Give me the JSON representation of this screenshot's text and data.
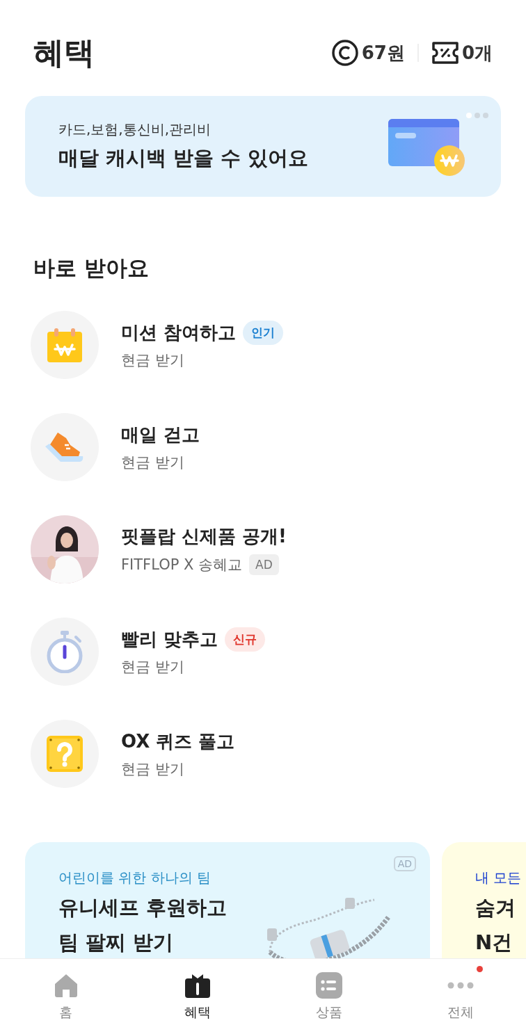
{
  "header": {
    "title": "혜택",
    "points": "67원",
    "coupons": "0개"
  },
  "banner": {
    "subtitle": "카드,보험,통신비,관리비",
    "title": "매달 캐시백 받을 수 있어요",
    "pages": [
      {
        "selected": true
      },
      {
        "selected": false
      },
      {
        "selected": false
      }
    ]
  },
  "section_title": "바로 받아요",
  "items": [
    {
      "kind": "calendar",
      "title": "미션 참여하고",
      "subtitle": "현금 받기",
      "badge": {
        "text": "인기",
        "kind": "popular"
      }
    },
    {
      "kind": "shoe",
      "title": "매일 걷고",
      "subtitle": "현금 받기"
    },
    {
      "kind": "picture",
      "title": "핏플랍 신제품 공개!",
      "subtitle": "FITFLOP X 송혜교",
      "badge": {
        "text": "AD",
        "kind": "ad"
      }
    },
    {
      "kind": "stopwatch",
      "title": "빨리 맞추고",
      "subtitle": "현금 받기",
      "badge": {
        "text": "신규",
        "kind": "new"
      }
    },
    {
      "kind": "quiz",
      "title": "OX 퀴즈 풀고",
      "subtitle": "현금 받기"
    }
  ],
  "promo_cards": [
    {
      "eyebrow": "어린이를 위한 하나의 팀",
      "title_lines": [
        "유니세프 후원하고",
        "팀 팔찌 받기"
      ],
      "ad_label": "AD",
      "color": "#e3f6fd",
      "kind": "bracelet"
    },
    {
      "eyebrow": "내 모든",
      "title_lines": [
        "숨겨",
        "N건"
      ],
      "color": "#fffde3",
      "kind": "plain"
    }
  ],
  "nav": [
    {
      "label": "홈",
      "kind": "home",
      "selected": false,
      "notification": false
    },
    {
      "label": "혜택",
      "kind": "gift",
      "selected": true,
      "notification": false
    },
    {
      "label": "상품",
      "kind": "list",
      "selected": false,
      "notification": false
    },
    {
      "label": "전체",
      "kind": "more",
      "selected": false,
      "notification": true
    }
  ]
}
